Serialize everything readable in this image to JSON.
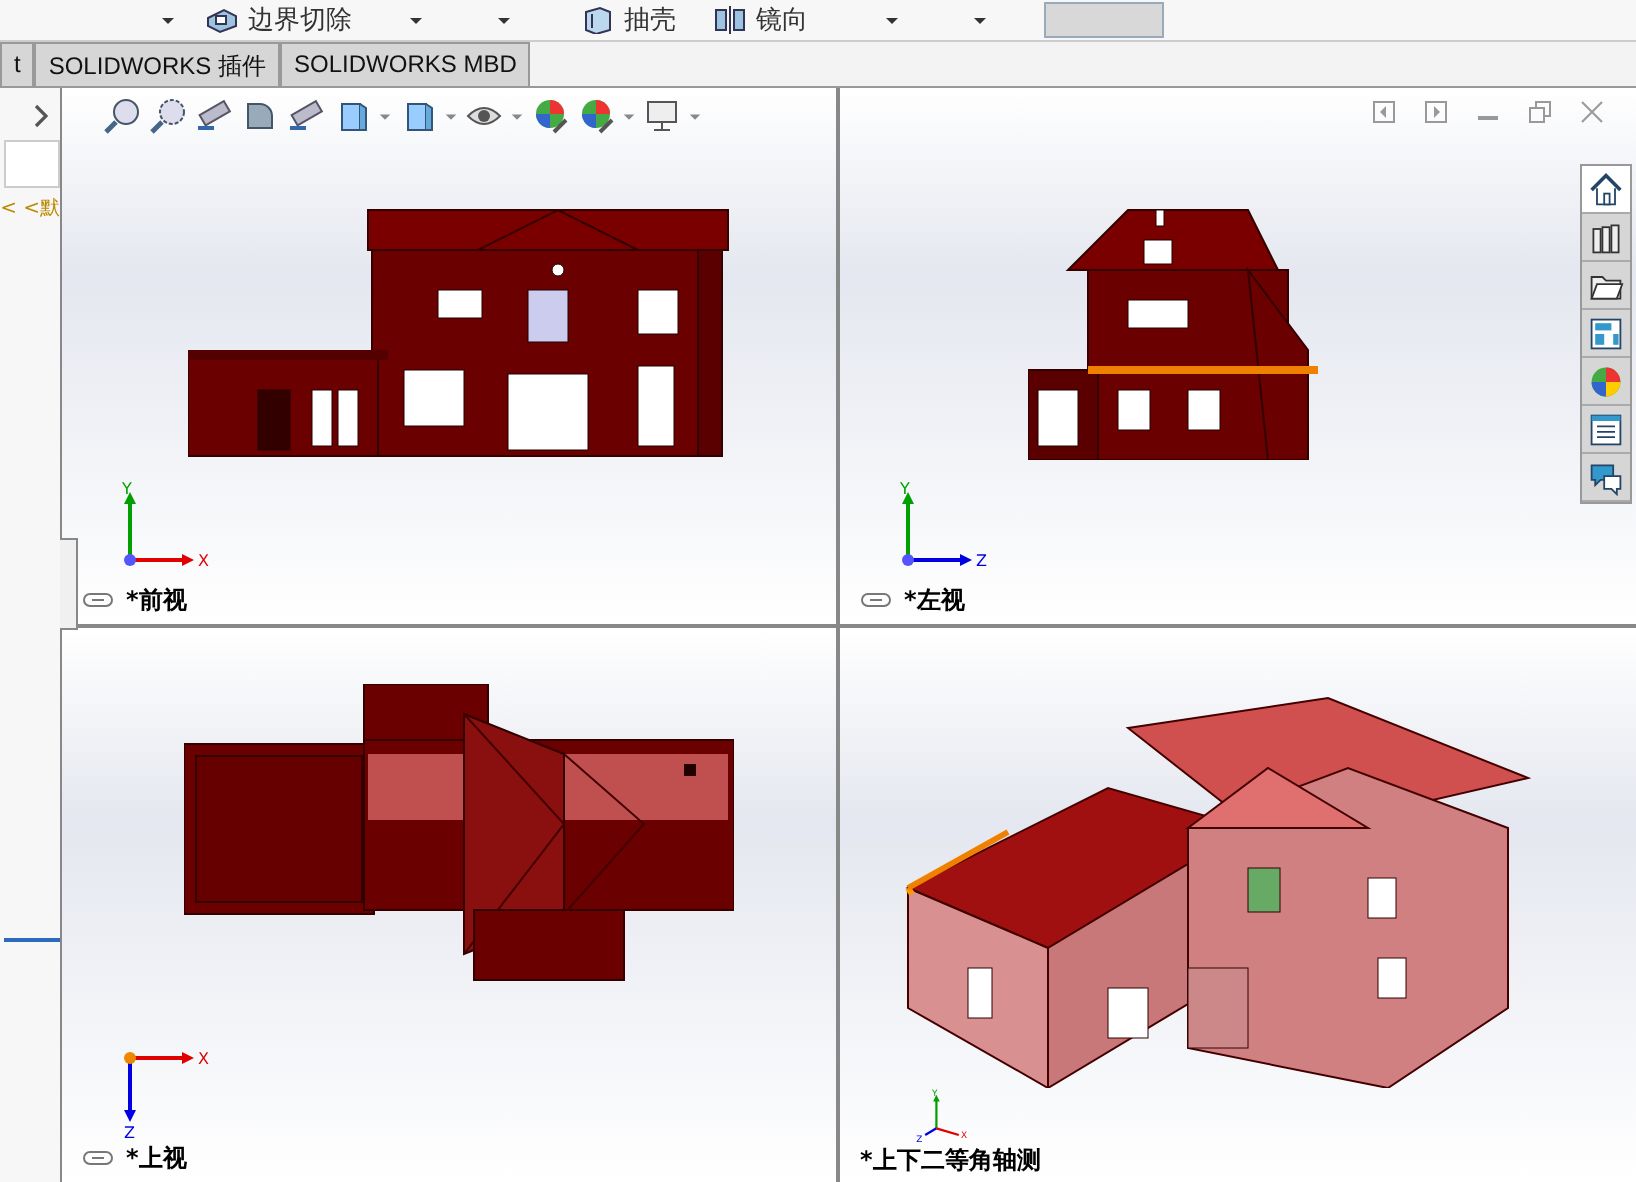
{
  "toolbar": {
    "buttons": [
      {
        "label": "边界切除",
        "kind": "cut"
      },
      {
        "label": "抽壳",
        "kind": "shell"
      },
      {
        "label": "镜向",
        "kind": "mirror"
      }
    ]
  },
  "tabs": [
    {
      "label": "t",
      "selected": false
    },
    {
      "label": "SOLIDWORKS 插件",
      "selected": false
    },
    {
      "label": "SOLIDWORKS MBD",
      "selected": false
    }
  ],
  "left_panel": {
    "note": "< <默"
  },
  "viewports": [
    {
      "label": "*前视",
      "kind": "front",
      "linked": true,
      "axes": [
        "Y",
        "X"
      ]
    },
    {
      "label": "*左视",
      "kind": "left",
      "linked": true,
      "axes": [
        "Y",
        "Z"
      ]
    },
    {
      "label": "*上视",
      "kind": "top",
      "linked": true,
      "axes": [
        "Z",
        "X"
      ]
    },
    {
      "label": "*上下二等角轴测",
      "kind": "iso",
      "linked": false,
      "axes": [
        "Y",
        "Z",
        "X"
      ]
    }
  ],
  "task_pane": {
    "tabs": [
      {
        "selected": true
      },
      {
        "selected": false
      },
      {
        "selected": false
      },
      {
        "selected": false
      },
      {
        "selected": false
      },
      {
        "selected": false
      },
      {
        "selected": false
      }
    ]
  }
}
